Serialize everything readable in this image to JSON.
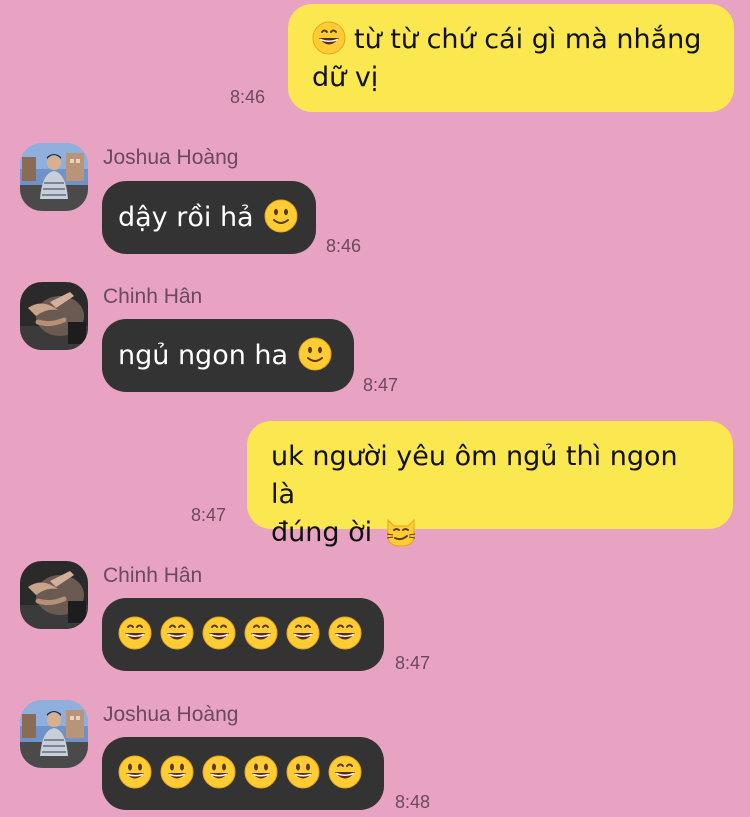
{
  "messages": [
    {
      "type": "outgoing",
      "lines": [
        "từ từ chứ cái gì mà nhắng",
        "dữ vị"
      ],
      "leading_emoji": "grin",
      "time": "8:46"
    },
    {
      "type": "incoming",
      "sender": "Joshua Hoàng",
      "avatar": "joshua",
      "text": "dậy rồi hả",
      "trailing_emoji": "smile",
      "time": "8:46"
    },
    {
      "type": "incoming",
      "sender": "Chinh Hân",
      "avatar": "chinh",
      "text": "ngủ ngon ha",
      "trailing_emoji": "smile",
      "time": "8:47"
    },
    {
      "type": "outgoing",
      "lines": [
        "uk người yêu ôm ngủ thì ngon là",
        "đúng ời"
      ],
      "trailing_emoji": "smirk-cat",
      "time": "8:47"
    },
    {
      "type": "incoming",
      "sender": "Chinh Hân",
      "avatar": "chinh",
      "emojis": [
        "grin",
        "grin",
        "grin",
        "grin",
        "grin",
        "grin"
      ],
      "time": "8:47"
    },
    {
      "type": "incoming",
      "sender": "Joshua Hoàng",
      "avatar": "joshua",
      "emojis": [
        "smiley",
        "smiley",
        "smiley",
        "smiley",
        "smiley",
        "grin"
      ],
      "time": "8:48"
    }
  ],
  "colors": {
    "background": "#e8a3c2",
    "outgoing_bubble": "#fbe74f",
    "incoming_bubble": "#333334"
  }
}
